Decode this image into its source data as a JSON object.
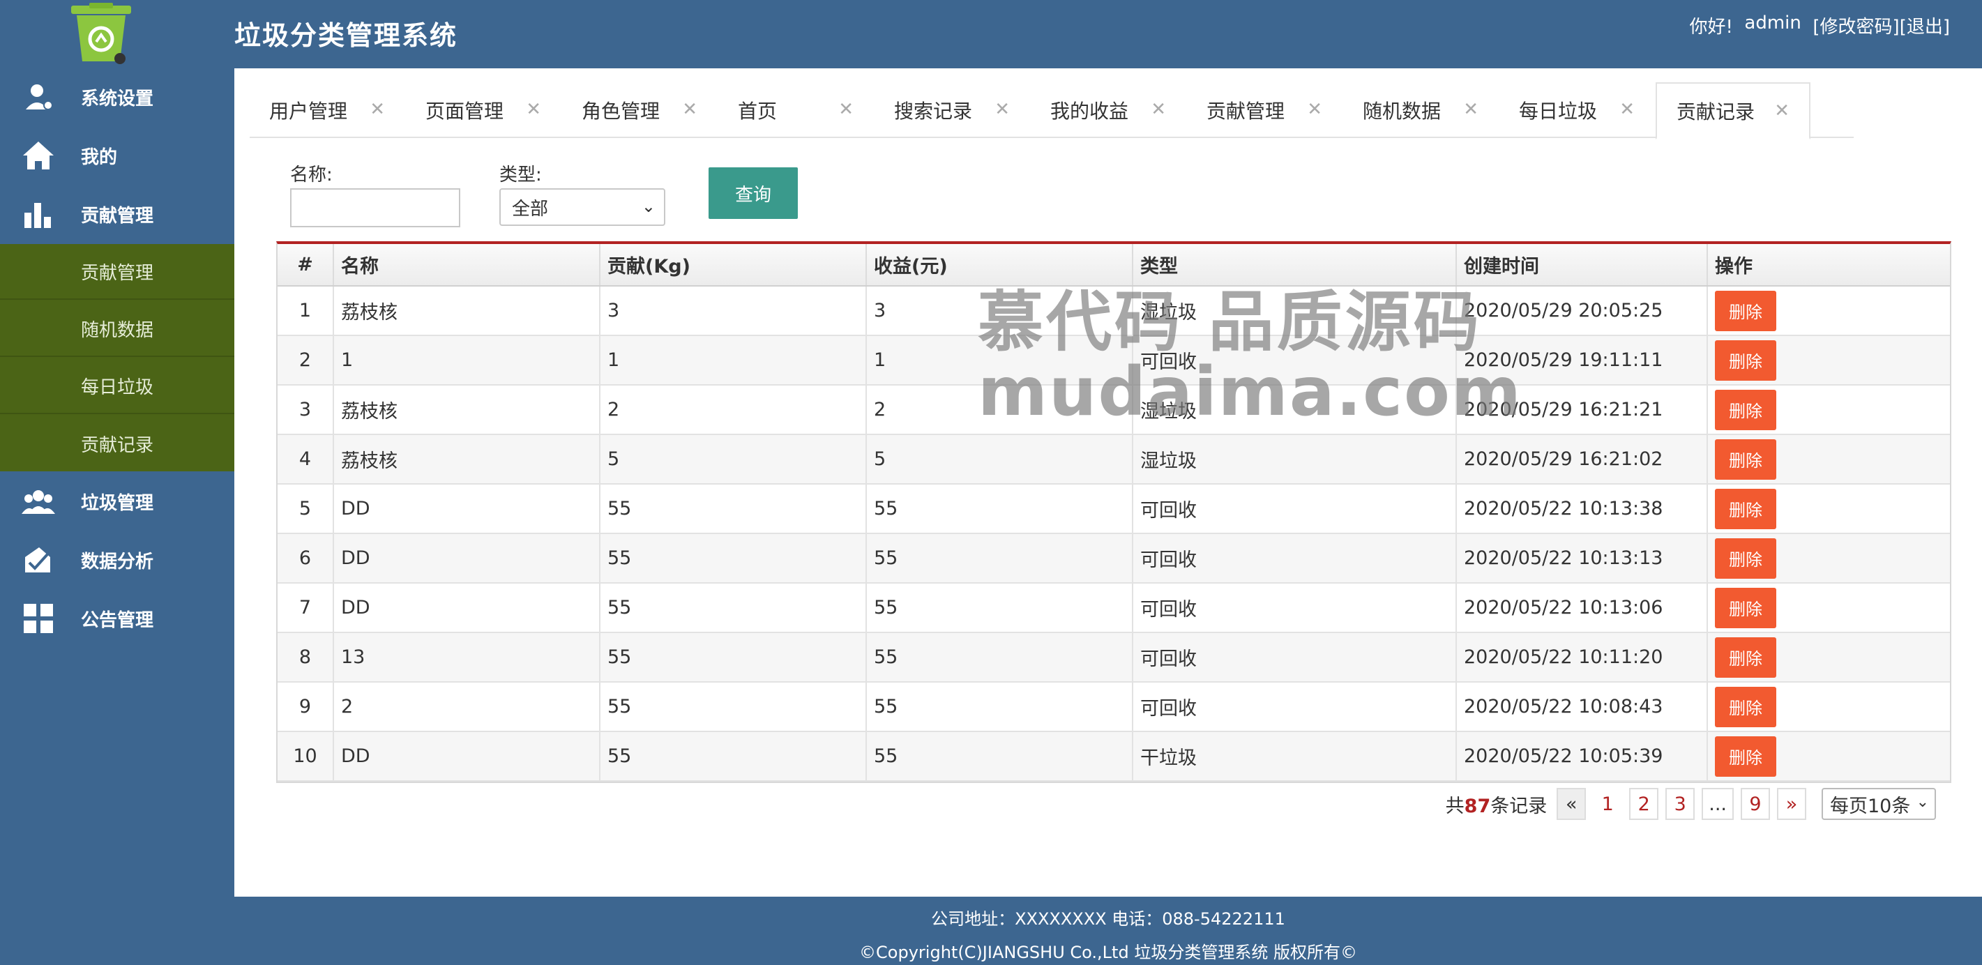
{
  "header": {
    "title": "垃圾分类管理系统",
    "greeting": "你好!",
    "username": "admin",
    "change_password": "[修改密码]",
    "logout": "[退出]"
  },
  "sidebar": {
    "items": [
      {
        "label": "系统设置",
        "icon": "user-gear-icon"
      },
      {
        "label": "我的",
        "icon": "home-icon"
      },
      {
        "label": "贡献管理",
        "icon": "bar-chart-icon"
      },
      {
        "label": "垃圾管理",
        "icon": "users-icon"
      },
      {
        "label": "数据分析",
        "icon": "analysis-icon"
      },
      {
        "label": "公告管理",
        "icon": "grid-icon"
      }
    ],
    "sub_items": [
      "贡献管理",
      "随机数据",
      "每日垃圾",
      "贡献记录"
    ]
  },
  "tabs": [
    "用户管理",
    "页面管理",
    "角色管理",
    "首页",
    "搜索记录",
    "我的收益",
    "贡献管理",
    "随机数据",
    "每日垃圾",
    "贡献记录"
  ],
  "active_tab": "贡献记录",
  "tab_close_glyph": "✕",
  "search": {
    "name_label": "名称:",
    "name_value": "",
    "type_label": "类型:",
    "type_value": "全部",
    "query_button": "查询"
  },
  "table": {
    "headers": [
      "#",
      "名称",
      "贡献(Kg)",
      "收益(元)",
      "类型",
      "创建时间",
      "操作"
    ],
    "delete_label": "删除",
    "rows": [
      [
        "1",
        "荔枝核",
        "3",
        "3",
        "湿垃圾",
        "2020/05/29 20:05:25"
      ],
      [
        "2",
        "1",
        "1",
        "1",
        "可回收",
        "2020/05/29 19:11:11"
      ],
      [
        "3",
        "荔枝核",
        "2",
        "2",
        "湿垃圾",
        "2020/05/29 16:21:21"
      ],
      [
        "4",
        "荔枝核",
        "5",
        "5",
        "湿垃圾",
        "2020/05/29 16:21:02"
      ],
      [
        "5",
        "DD",
        "55",
        "55",
        "可回收",
        "2020/05/22 10:13:38"
      ],
      [
        "6",
        "DD",
        "55",
        "55",
        "可回收",
        "2020/05/22 10:13:13"
      ],
      [
        "7",
        "DD",
        "55",
        "55",
        "可回收",
        "2020/05/22 10:13:06"
      ],
      [
        "8",
        "13",
        "55",
        "55",
        "可回收",
        "2020/05/22 10:11:20"
      ],
      [
        "9",
        "2",
        "55",
        "55",
        "可回收",
        "2020/05/22 10:08:43"
      ],
      [
        "10",
        "DD",
        "55",
        "55",
        "干垃圾",
        "2020/05/22 10:05:39"
      ]
    ]
  },
  "pagination": {
    "total_prefix": "共",
    "total_count": "87",
    "total_suffix": "条记录",
    "prev": "«",
    "pages": [
      "1",
      "2",
      "3",
      "...",
      "9"
    ],
    "next": "»",
    "page_size": "每页10条"
  },
  "watermark": {
    "line1": "慕代码 品质源码",
    "line2": "mudaima.com"
  },
  "footer": {
    "line1": "公司地址：XXXXXXXX 电话：088-54222111",
    "line2": "©Copyright(C)JIANGSHU Co.,Ltd 垃圾分类管理系统 版权所有©"
  },
  "colors": {
    "primary": "#3d6690",
    "submenu": "#4b6416",
    "query_button": "#3a9a8c",
    "delete_button": "#f25a30",
    "accent_red": "#b22222"
  }
}
